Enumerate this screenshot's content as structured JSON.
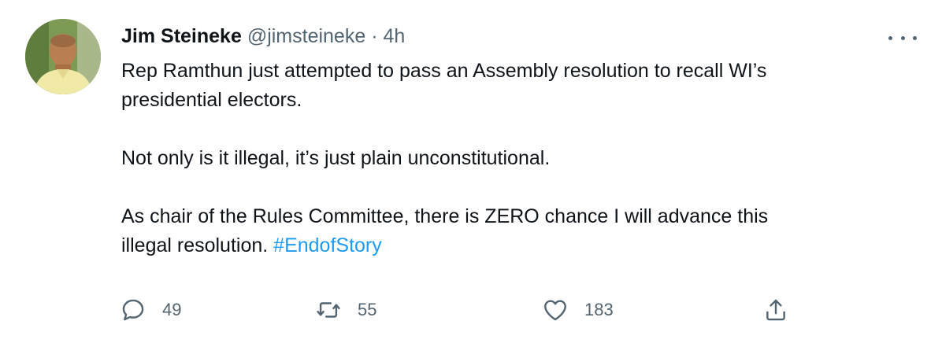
{
  "tweet": {
    "author_name": "Jim Steineke",
    "author_handle": "@jimsteineke",
    "separator": "·",
    "time": "4h",
    "text_line1": "Rep Ramthun just attempted to pass an Assembly resolution to recall WI’s",
    "text_line2": "presidential electors.",
    "text_para2": "Not only is it illegal, it’s just plain unconstitutional.",
    "text_para3_line1": "As chair of the Rules Committee, there is ZERO chance I will advance this",
    "text_para3_line2": "illegal resolution.",
    "hashtag": "#EndofStory"
  },
  "actions": {
    "reply_count": "49",
    "retweet_count": "55",
    "like_count": "183"
  },
  "icons": {
    "more": "more-horizontal-icon",
    "reply": "reply-icon",
    "retweet": "retweet-icon",
    "like": "heart-icon",
    "share": "share-icon"
  },
  "colors": {
    "text": "#0f1419",
    "secondary": "#536471",
    "link": "#1d9bf0"
  }
}
